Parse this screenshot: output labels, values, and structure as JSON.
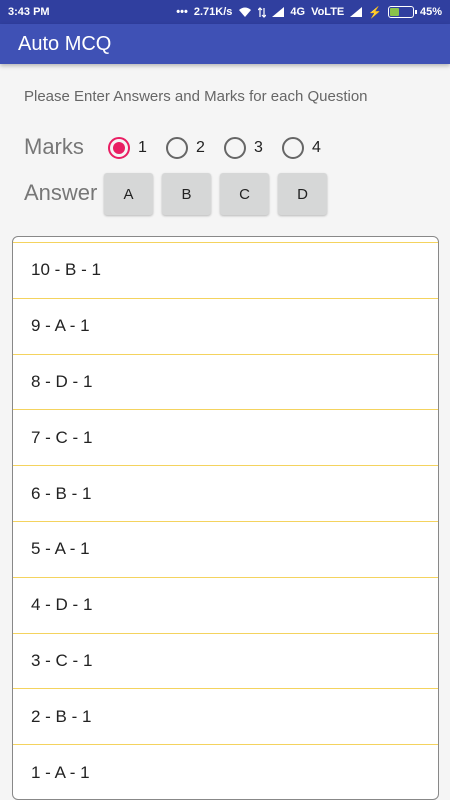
{
  "status_bar": {
    "time": "3:43 PM",
    "dots": "•••",
    "speed": "2.71K/s",
    "network": "4G",
    "volte": "VoLTE",
    "charge_symbol": "⚡",
    "battery": "45%",
    "battery_level": 0.45
  },
  "app_bar": {
    "title": "Auto MCQ"
  },
  "instruction": "Please Enter Answers and Marks for each Question",
  "marks": {
    "label": "Marks",
    "options": [
      "1",
      "2",
      "3",
      "4"
    ],
    "selected": "1",
    "accent_color": "#e91e63"
  },
  "answer": {
    "label": "Answer",
    "buttons": [
      "A",
      "B",
      "C",
      "D"
    ]
  },
  "entries": [
    "10 - B - 1",
    "9 - A - 1",
    "8 - D - 1",
    "7 - C - 1",
    "6 - B - 1",
    "5 - A - 1",
    "4 - D - 1",
    "3 - C - 1",
    "2 - B - 1",
    "1 - A - 1"
  ]
}
